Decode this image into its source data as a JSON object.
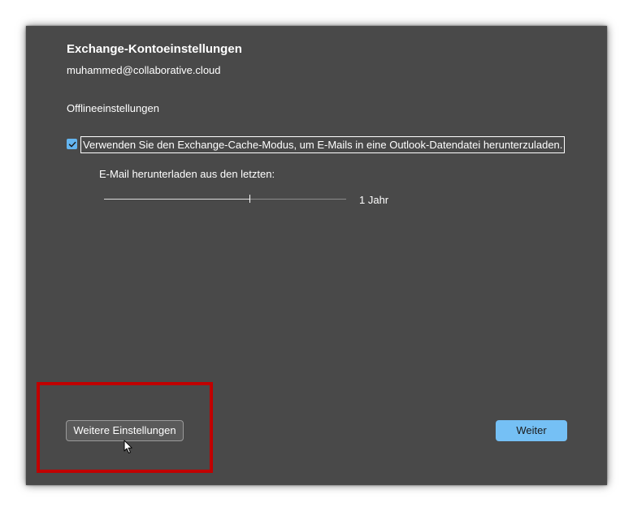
{
  "dialog": {
    "title": "Exchange-Kontoeinstellungen",
    "account_email": "muhammed@collaborative.cloud",
    "section_label": "Offlineeinstellungen",
    "cache_mode": {
      "checked": true,
      "label": "Verwenden Sie den Exchange-Cache-Modus, um E-Mails in eine Outlook-Datendatei herunterzuladen."
    },
    "download_slider": {
      "label": "E-Mail herunterladen aus den letzten:",
      "value_text": "1 Jahr",
      "position": 0.6
    },
    "buttons": {
      "more_settings": "Weitere Einstellungen",
      "next": "Weiter"
    }
  },
  "colors": {
    "dialog_background": "#494949",
    "accent": "#75c0f5",
    "highlight": "#c00000"
  },
  "icons": {
    "checkbox": "checkmark-icon",
    "cursor": "mouse-pointer-icon"
  }
}
